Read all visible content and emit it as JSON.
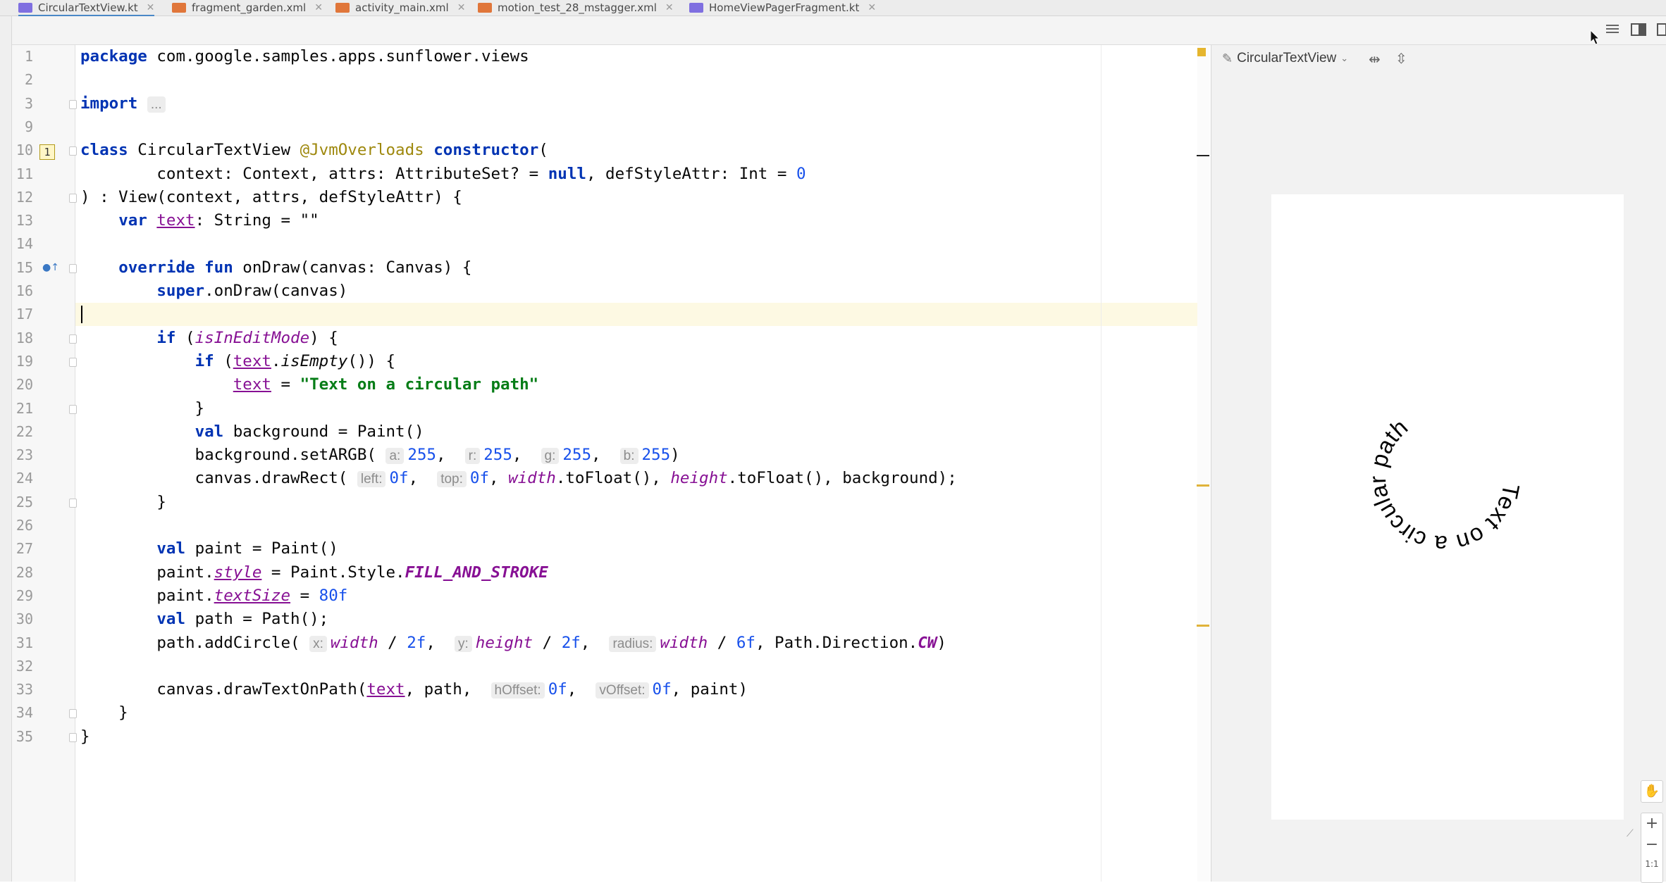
{
  "tabs": [
    {
      "label": "CircularTextView.kt",
      "icon": "kotlin-file-icon",
      "color": "#7f6fe0",
      "active": true
    },
    {
      "label": "fragment_garden.xml",
      "icon": "xml-file-icon",
      "color": "#e0763a",
      "active": false
    },
    {
      "label": "activity_main.xml",
      "icon": "xml-file-icon",
      "color": "#e0763a",
      "active": false
    },
    {
      "label": "motion_test_28_mstagger.xml",
      "icon": "xml-file-icon",
      "color": "#e0763a",
      "active": false
    },
    {
      "label": "HomeViewPagerFragment.kt",
      "icon": "kotlin-file-icon",
      "color": "#7f6fe0",
      "active": false
    }
  ],
  "editor": {
    "current_line": "17",
    "error_badge": "1",
    "lines": [
      {
        "num": "1",
        "segs": [
          [
            "kw",
            "package"
          ],
          [
            "",
            "com.google.samples.apps.sunflower.views"
          ]
        ]
      },
      {
        "num": "2",
        "segs": []
      },
      {
        "num": "3",
        "segs": [
          [
            "kw",
            "import"
          ],
          [
            "",
            ""
          ],
          [
            "fold",
            "..."
          ]
        ]
      },
      {
        "num": "9",
        "segs": []
      },
      {
        "num": "10",
        "segs": [
          [
            "kw",
            "class"
          ],
          [
            "",
            "CircularTextView"
          ],
          [
            "ann",
            "@JvmOverloads"
          ],
          [
            "kw",
            "constructor"
          ],
          [
            "",
            "("
          ]
        ]
      },
      {
        "num": "11",
        "segs": [
          [
            "",
            "        context: Context, attrs: AttributeSet? = "
          ],
          [
            "kw",
            "null"
          ],
          [
            "",
            ", defStyleAttr: Int = "
          ],
          [
            "num",
            "0"
          ]
        ]
      },
      {
        "num": "12",
        "segs": [
          [
            "",
            ") : View(context, attrs, defStyleAttr) {"
          ]
        ]
      },
      {
        "num": "13",
        "segs": [
          [
            "",
            "    "
          ],
          [
            "kw",
            "var "
          ],
          [
            "propu",
            "text"
          ],
          [
            "",
            ": String = \"\""
          ]
        ]
      },
      {
        "num": "14",
        "segs": []
      },
      {
        "num": "15",
        "segs": [
          [
            "",
            "    "
          ],
          [
            "kw",
            "override fun "
          ],
          [
            "",
            "onDraw(canvas: Canvas) {"
          ]
        ]
      },
      {
        "num": "16",
        "segs": [
          [
            "",
            "        "
          ],
          [
            "kw",
            "super"
          ],
          [
            "",
            ".onDraw(canvas)"
          ]
        ]
      },
      {
        "num": "17",
        "segs": []
      },
      {
        "num": "18",
        "segs": [
          [
            "",
            "        "
          ],
          [
            "kw",
            "if "
          ],
          [
            "",
            "("
          ],
          [
            "propi",
            "isInEditMode"
          ],
          [
            "",
            ") {"
          ]
        ]
      },
      {
        "num": "19",
        "segs": [
          [
            "",
            "            "
          ],
          [
            "kw",
            "if "
          ],
          [
            "",
            "("
          ],
          [
            "propu",
            "text"
          ],
          [
            "",
            "."
          ],
          [
            "ital",
            "isEmpty"
          ],
          [
            "",
            "()) {"
          ]
        ]
      },
      {
        "num": "20",
        "segs": [
          [
            "",
            "                "
          ],
          [
            "propu",
            "text"
          ],
          [
            "",
            " = "
          ],
          [
            "str",
            "\"Text on a circular path\""
          ]
        ]
      },
      {
        "num": "21",
        "segs": [
          [
            "",
            "            }"
          ]
        ]
      },
      {
        "num": "22",
        "segs": [
          [
            "",
            "            "
          ],
          [
            "kw",
            "val "
          ],
          [
            "",
            "background = Paint()"
          ]
        ]
      },
      {
        "num": "23",
        "segs": [
          [
            "",
            "            background.setARGB( "
          ],
          [
            "hint",
            "a:"
          ],
          [
            "num",
            "255"
          ],
          [
            "",
            ",  "
          ],
          [
            "hint",
            "r:"
          ],
          [
            "num",
            "255"
          ],
          [
            "",
            ",  "
          ],
          [
            "hint",
            "g:"
          ],
          [
            "num",
            "255"
          ],
          [
            "",
            ",  "
          ],
          [
            "hint",
            "b:"
          ],
          [
            "num",
            "255"
          ],
          [
            "",
            ")"
          ]
        ]
      },
      {
        "num": "24",
        "segs": [
          [
            "",
            "            canvas.drawRect( "
          ],
          [
            "hint",
            "left:"
          ],
          [
            "num",
            "0f"
          ],
          [
            "",
            ",  "
          ],
          [
            "hint",
            "top:"
          ],
          [
            "num",
            "0f"
          ],
          [
            "",
            ", "
          ],
          [
            "propi",
            "width"
          ],
          [
            "",
            ".toFloat(), "
          ],
          [
            "propi",
            "height"
          ],
          [
            "",
            ".toFloat(), background);"
          ]
        ]
      },
      {
        "num": "25",
        "segs": [
          [
            "",
            "        }"
          ]
        ]
      },
      {
        "num": "26",
        "segs": []
      },
      {
        "num": "27",
        "segs": [
          [
            "",
            "        "
          ],
          [
            "kw",
            "val "
          ],
          [
            "",
            "paint = Paint()"
          ]
        ]
      },
      {
        "num": "28",
        "segs": [
          [
            "",
            "        paint."
          ],
          [
            "propiu",
            "style"
          ],
          [
            "",
            " = Paint.Style."
          ],
          [
            "constb",
            "FILL_AND_STROKE"
          ]
        ]
      },
      {
        "num": "29",
        "segs": [
          [
            "",
            "        paint."
          ],
          [
            "propiu",
            "textSize"
          ],
          [
            "",
            " = "
          ],
          [
            "num",
            "80f"
          ]
        ]
      },
      {
        "num": "30",
        "segs": [
          [
            "",
            "        "
          ],
          [
            "kw",
            "val "
          ],
          [
            "",
            "path = Path();"
          ]
        ]
      },
      {
        "num": "31",
        "segs": [
          [
            "",
            "        path.addCircle( "
          ],
          [
            "hint",
            "x:"
          ],
          [
            "propi",
            "width"
          ],
          [
            "",
            " / "
          ],
          [
            "num",
            "2f"
          ],
          [
            "",
            ",  "
          ],
          [
            "hint",
            "y:"
          ],
          [
            "propi",
            "height"
          ],
          [
            "",
            " / "
          ],
          [
            "num",
            "2f"
          ],
          [
            "",
            ",  "
          ],
          [
            "hint",
            "radius:"
          ],
          [
            "propi",
            "width"
          ],
          [
            "",
            " / "
          ],
          [
            "num",
            "6f"
          ],
          [
            "",
            ", Path.Direction."
          ],
          [
            "constb",
            "CW"
          ],
          [
            "",
            ")"
          ]
        ]
      },
      {
        "num": "32",
        "segs": []
      },
      {
        "num": "33",
        "segs": [
          [
            "",
            "        canvas.drawTextOnPath("
          ],
          [
            "propu",
            "text"
          ],
          [
            "",
            ", path,  "
          ],
          [
            "hint",
            "hOffset:"
          ],
          [
            "num",
            "0f"
          ],
          [
            "",
            ",  "
          ],
          [
            "hint",
            "vOffset:"
          ],
          [
            "num",
            "0f"
          ],
          [
            "",
            ", paint)"
          ]
        ]
      },
      {
        "num": "34",
        "segs": [
          [
            "",
            "    }"
          ]
        ]
      },
      {
        "num": "35",
        "segs": [
          [
            "",
            "}"
          ]
        ]
      }
    ]
  },
  "preview": {
    "component_label": "CircularTextView",
    "circular_text": "Text on a circular path",
    "zoom_in": "+",
    "zoom_out": "−",
    "zoom_ratio": "1:1"
  },
  "colors": {
    "keyword": "#0033b3",
    "string": "#067d17",
    "number": "#1750eb",
    "property": "#871094",
    "annotation": "#9e880d",
    "current_line": "#fdf9e3"
  }
}
